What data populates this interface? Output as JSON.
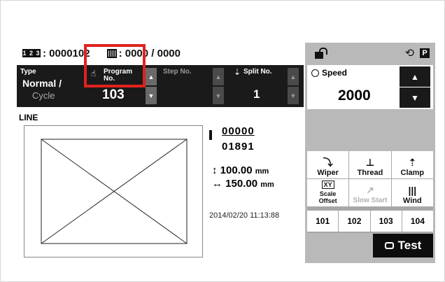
{
  "status": {
    "counter_icon_text": "1 2 3",
    "counter_value": ": 0000102",
    "bobbin_value": ": 0000 / 0000"
  },
  "params": {
    "type_label": "Type",
    "type_value_1": "Normal /",
    "type_value_2": "Cycle",
    "program_label_1": "Program",
    "program_label_2": "No.",
    "program_value": "103",
    "step_label": "Step No.",
    "split_label": "Split No.",
    "split_value": "1",
    "up": "▲",
    "down": "▼"
  },
  "content": {
    "line_label": "LINE",
    "stitch_current": "00000",
    "stitch_total": "01891",
    "height_value": "100.00",
    "width_value": "150.00",
    "unit": "mm",
    "timestamp": "2014/02/20 11:13:88"
  },
  "right": {
    "p_icon": "P",
    "speed_label": "Speed",
    "speed_value": "2000",
    "functions": [
      {
        "label": "Wiper",
        "glyph": "⤵"
      },
      {
        "label": "Thread",
        "glyph": "⊥"
      },
      {
        "label": "Clamp",
        "glyph": "⇡"
      },
      {
        "label": "Scale",
        "label2": "Offset",
        "glyph": "XY"
      },
      {
        "label": "Slow Start",
        "glyph": "↗"
      },
      {
        "label": "Wind",
        "glyph": "|||"
      }
    ],
    "programs": [
      "101",
      "102",
      "103",
      "104"
    ],
    "test_label": "Test"
  },
  "colors": {
    "highlight": "#e0221e",
    "panel": "#b9b9b9",
    "dark": "#1a1a1a"
  }
}
